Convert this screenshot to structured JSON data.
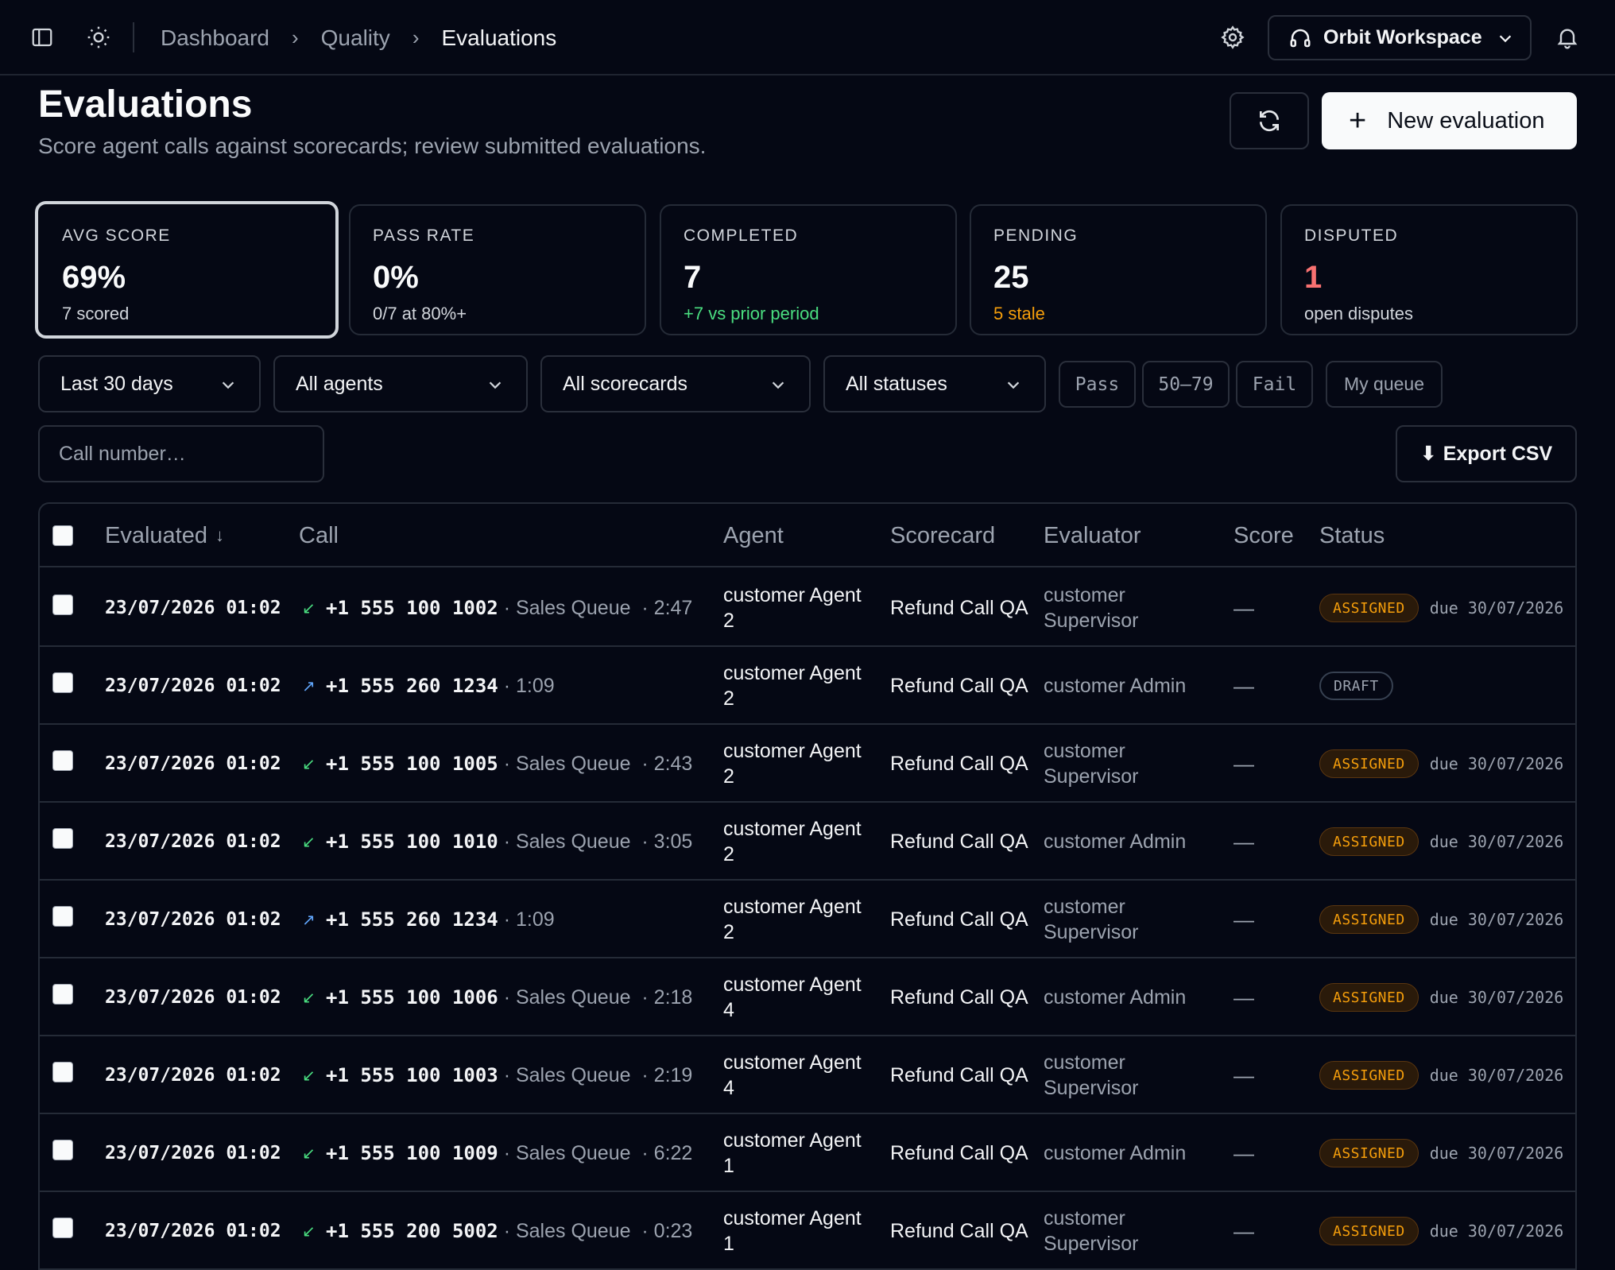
{
  "breadcrumb": [
    "Dashboard",
    "Quality",
    "Evaluations"
  ],
  "workspace": {
    "label": "Orbit Workspace"
  },
  "header": {
    "title": "Evaluations",
    "subtitle": "Score agent calls against scorecards; review submitted evaluations.",
    "new_button": "New evaluation"
  },
  "stats": [
    {
      "label": "AVG SCORE",
      "value": "69%",
      "note": "7 scored"
    },
    {
      "label": "PASS RATE",
      "value": "0%",
      "note": "0/7 at 80%+"
    },
    {
      "label": "COMPLETED",
      "value": "7",
      "note": "+7 vs prior period"
    },
    {
      "label": "PENDING",
      "value": "25",
      "note": "5 stale"
    },
    {
      "label": "DISPUTED",
      "value": "1",
      "note": "open disputes"
    }
  ],
  "filters": {
    "period": "Last 30 days",
    "agents": "All agents",
    "scorecards": "All scorecards",
    "statuses": "All statuses",
    "chips": [
      "Pass",
      "50–79",
      "Fail",
      "My queue"
    ],
    "search_placeholder": "Call number…",
    "export": "Export CSV"
  },
  "table": {
    "columns": [
      "Evaluated",
      "Call",
      "Agent",
      "Scorecard",
      "Evaluator",
      "Score",
      "Status"
    ],
    "rows": [
      {
        "date": "23/07/2026 01:02",
        "dir": "in",
        "number": "+1 555 100 1002",
        "meta": " · Sales Queue  · 2:47",
        "agent": "customer Agent 2",
        "scorecard": "Refund Call QA",
        "evaluator": "customer Supervisor",
        "score": "—",
        "status": "ASSIGNED",
        "due": "due 30/07/2026"
      },
      {
        "date": "23/07/2026 01:02",
        "dir": "out",
        "number": "+1 555 260 1234",
        "meta": " · 1:09",
        "agent": "customer Agent 2",
        "scorecard": "Refund Call QA",
        "evaluator": "customer Admin",
        "score": "—",
        "status": "DRAFT",
        "due": ""
      },
      {
        "date": "23/07/2026 01:02",
        "dir": "in",
        "number": "+1 555 100 1005",
        "meta": " · Sales Queue  · 2:43",
        "agent": "customer Agent 2",
        "scorecard": "Refund Call QA",
        "evaluator": "customer Supervisor",
        "score": "—",
        "status": "ASSIGNED",
        "due": "due 30/07/2026"
      },
      {
        "date": "23/07/2026 01:02",
        "dir": "in",
        "number": "+1 555 100 1010",
        "meta": " · Sales Queue  · 3:05",
        "agent": "customer Agent 2",
        "scorecard": "Refund Call QA",
        "evaluator": "customer Admin",
        "score": "—",
        "status": "ASSIGNED",
        "due": "due 30/07/2026"
      },
      {
        "date": "23/07/2026 01:02",
        "dir": "out",
        "number": "+1 555 260 1234",
        "meta": " · 1:09",
        "agent": "customer Agent 2",
        "scorecard": "Refund Call QA",
        "evaluator": "customer Supervisor",
        "score": "—",
        "status": "ASSIGNED",
        "due": "due 30/07/2026"
      },
      {
        "date": "23/07/2026 01:02",
        "dir": "in",
        "number": "+1 555 100 1006",
        "meta": " · Sales Queue  · 2:18",
        "agent": "customer Agent 4",
        "scorecard": "Refund Call QA",
        "evaluator": "customer Admin",
        "score": "—",
        "status": "ASSIGNED",
        "due": "due 30/07/2026"
      },
      {
        "date": "23/07/2026 01:02",
        "dir": "in",
        "number": "+1 555 100 1003",
        "meta": " · Sales Queue  · 2:19",
        "agent": "customer Agent 4",
        "scorecard": "Refund Call QA",
        "evaluator": "customer Supervisor",
        "score": "—",
        "status": "ASSIGNED",
        "due": "due 30/07/2026"
      },
      {
        "date": "23/07/2026 01:02",
        "dir": "in",
        "number": "+1 555 100 1009",
        "meta": " · Sales Queue  · 6:22",
        "agent": "customer Agent 1",
        "scorecard": "Refund Call QA",
        "evaluator": "customer Admin",
        "score": "—",
        "status": "ASSIGNED",
        "due": "due 30/07/2026"
      },
      {
        "date": "23/07/2026 01:02",
        "dir": "in",
        "number": "+1 555 200 5002",
        "meta": " · Sales Queue  · 0:23",
        "agent": "customer Agent 1",
        "scorecard": "Refund Call QA",
        "evaluator": "customer Supervisor",
        "score": "—",
        "status": "ASSIGNED",
        "due": "due 30/07/2026"
      }
    ]
  },
  "colors": {
    "background": "#050814",
    "inbound": "#4ade80",
    "outbound": "#60a5fa",
    "assigned": "#f59e0b",
    "disputed": "#f87171"
  }
}
